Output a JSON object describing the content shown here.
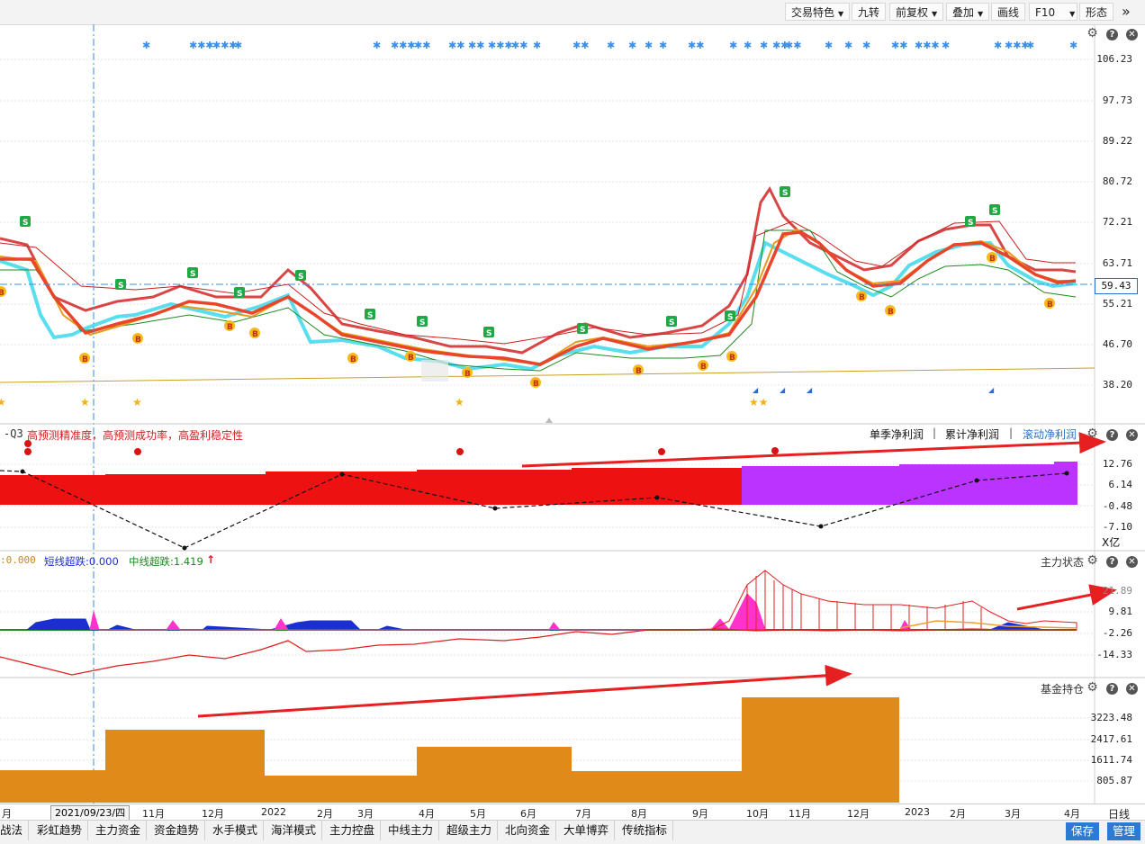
{
  "toolbar": {
    "buttons": [
      {
        "label": "交易特色",
        "caret": true
      },
      {
        "label": "九转",
        "caret": false
      },
      {
        "label": "前复权",
        "caret": true
      },
      {
        "label": "叠加",
        "caret": true
      },
      {
        "label": "画线",
        "caret": false
      },
      {
        "label": "F10",
        "caret": true
      },
      {
        "label": "形态",
        "caret": false
      }
    ],
    "more_glyph": "»"
  },
  "main_pane": {
    "price_ticks": [
      "106.23",
      "97.73",
      "89.22",
      "80.72",
      "72.21",
      "63.71",
      "55.21",
      "46.70",
      "38.20"
    ],
    "current_price": "59.43",
    "signal_labels": {
      "sell": "S",
      "buy": "B"
    }
  },
  "profit_pane": {
    "left_label": "-Q3",
    "desc": "高预测精准度，高预测成功率，高盈利稳定性",
    "options": [
      "单季净利润",
      "累计净利润",
      "滚动净利润"
    ],
    "separator": "|",
    "ticks": [
      "12.76",
      "6.14",
      "-0.48",
      "-7.10"
    ],
    "unit": "X亿",
    "colors": {
      "red": "#ee1111",
      "purple": "#bb33ff"
    }
  },
  "force_pane": {
    "legend_a": ":0.000",
    "legend_b": "短线超跌:0.000",
    "legend_c": "中线超跌:1.419",
    "arrow": "↑",
    "title": "主力状态",
    "ticks": [
      "9.81",
      "-2.26",
      "-14.33"
    ],
    "partial_tick": "21.89"
  },
  "fund_pane": {
    "title": "基金持仓",
    "ticks": [
      "3223.48",
      "2417.61",
      "1611.74",
      "805.87"
    ],
    "bar_color": "#e08a1a"
  },
  "date_axis": {
    "selected": "2021/09/23/四",
    "labels": [
      "月",
      "11月",
      "12月",
      "2022",
      "2月",
      "3月",
      "4月",
      "5月",
      "6月",
      "7月",
      "8月",
      "9月",
      "10月",
      "11月",
      "12月",
      "2023",
      "2月",
      "3月",
      "4月"
    ],
    "period": "日线"
  },
  "bottom_tabs": [
    "战法",
    "彩虹趋势",
    "主力资金",
    "资金趋势",
    "水手模式",
    "海洋模式",
    "主力控盘",
    "中线主力",
    "超级主力",
    "北向资金",
    "大单博弈",
    "传统指标"
  ],
  "actions": {
    "save": "保存",
    "manage": "管理"
  }
}
